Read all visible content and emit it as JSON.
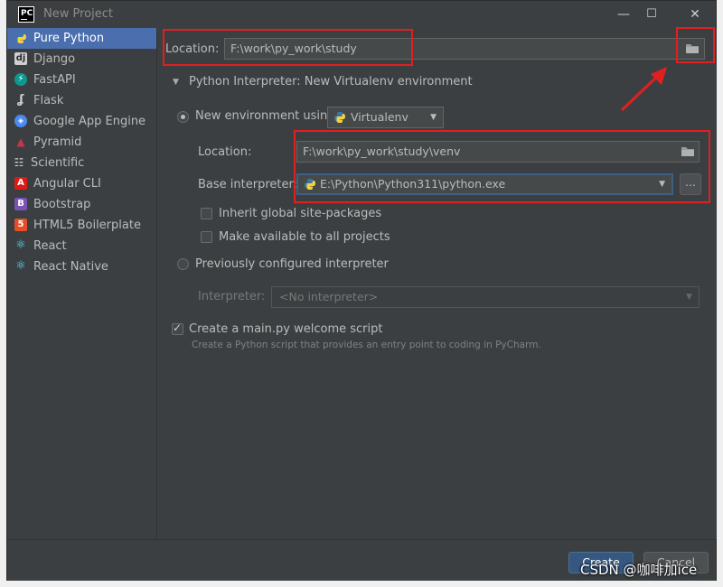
{
  "window": {
    "app_icon_text": "PC",
    "title": "New Project",
    "minimize": "—",
    "maximize": "☐",
    "close": "✕"
  },
  "sidebar": {
    "items": [
      {
        "label": "Pure Python",
        "icon": "python-icon",
        "selected": true
      },
      {
        "label": "Django",
        "icon": "django-icon"
      },
      {
        "label": "FastAPI",
        "icon": "fastapi-icon"
      },
      {
        "label": "Flask",
        "icon": "flask-icon"
      },
      {
        "label": "Google App Engine",
        "icon": "google-app-engine-icon"
      },
      {
        "label": "Pyramid",
        "icon": "pyramid-icon"
      },
      {
        "label": "Scientific",
        "icon": "scientific-icon"
      },
      {
        "label": "Angular CLI",
        "icon": "angular-icon"
      },
      {
        "label": "Bootstrap",
        "icon": "bootstrap-icon"
      },
      {
        "label": "HTML5 Boilerplate",
        "icon": "html5-icon"
      },
      {
        "label": "React",
        "icon": "react-icon"
      },
      {
        "label": "React Native",
        "icon": "react-native-icon"
      }
    ]
  },
  "main": {
    "location_label": "Location:",
    "location_value": "F:\\work\\py_work\\study",
    "interpreter_section_title": "Python Interpreter: New Virtualenv environment",
    "new_env_label": "New environment using",
    "new_env_tool": "Virtualenv",
    "venv_location_label": "Location:",
    "venv_location_value": "F:\\work\\py_work\\study\\venv",
    "base_interpreter_label": "Base interpreter:",
    "base_interpreter_value": "E:\\Python\\Python311\\python.exe",
    "browse_button": "...",
    "inherit_label": "Inherit global site-packages",
    "make_available_label": "Make available to all projects",
    "previous_label": "Previously configured interpreter",
    "interpreter_label": "Interpreter:",
    "interpreter_value": "<No interpreter>",
    "create_main_label": "Create a main.py welcome script",
    "create_main_hint": "Create a Python script that provides an entry point to coding in PyCharm."
  },
  "footer": {
    "create_button": "Create",
    "cancel_button": "Cancel"
  },
  "watermark": "CSDN @咖啡加ice",
  "colors": {
    "background": "#3c3f41",
    "selection": "#4b6eaf",
    "annotation_red": "#e02020",
    "primary_button": "#365880"
  }
}
